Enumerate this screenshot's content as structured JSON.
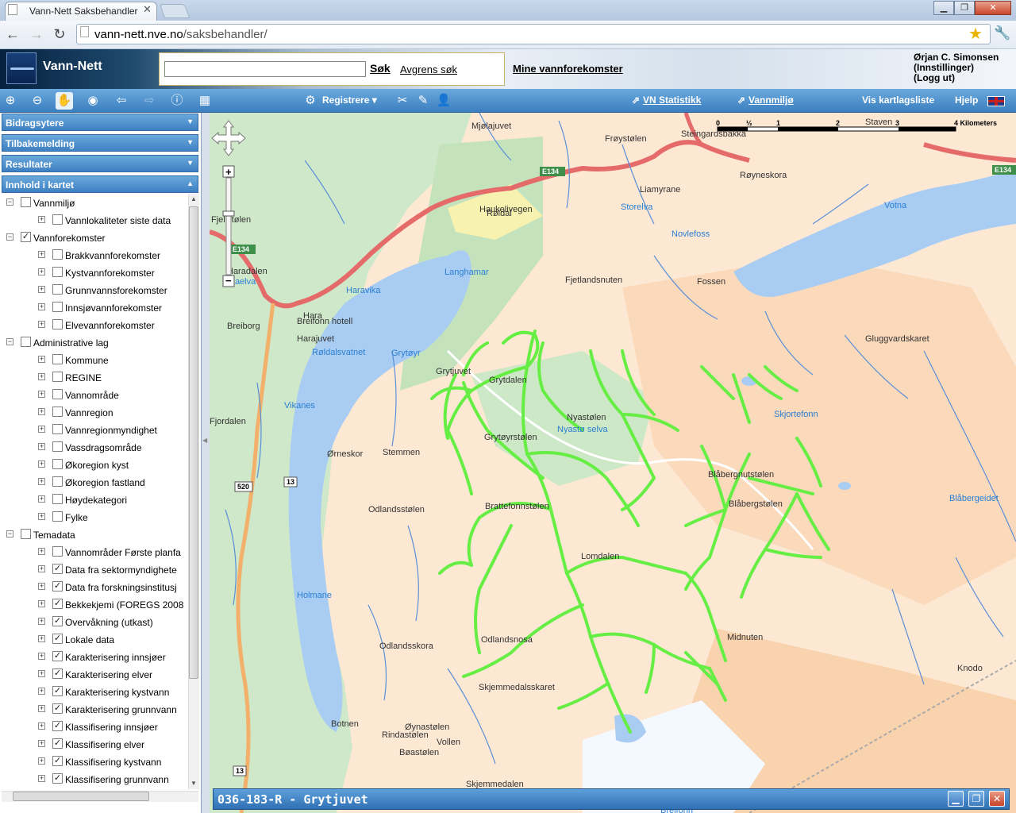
{
  "browser": {
    "tab_title": "Vann-Nett Saksbehandler",
    "url_domain": "vann-nett.nve.no",
    "url_path": "/saksbehandler/"
  },
  "header": {
    "app_title": "Vann-Nett",
    "search_button": "Søk",
    "refine_search": "Avgrens søk",
    "my_water_bodies": "Mine vannforekomster",
    "user_name": "Ørjan C. Simonsen",
    "settings": "(Innstillinger)",
    "logout": "(Logg ut)"
  },
  "toolbar": {
    "register": "Registrere",
    "vn_statistics": "VN Statistikk",
    "water_environment": "Vannmiljø",
    "show_layer_list": "Vis kartlagsliste",
    "help": "Hjelp"
  },
  "sidebar": {
    "panels": [
      "Bidragsytere",
      "Tilbakemelding",
      "Resultater",
      "Innhold i kartet"
    ],
    "tree": [
      {
        "label": "Vannmiljø",
        "level": 0,
        "checked": false,
        "expanded": true
      },
      {
        "label": "Vannlokaliteter siste data",
        "level": 1,
        "checked": false,
        "expanded": false
      },
      {
        "label": "Vannforekomster",
        "level": 0,
        "checked": true,
        "expanded": true
      },
      {
        "label": "Brakkvannforekomster",
        "level": 1,
        "checked": false,
        "expanded": false
      },
      {
        "label": "Kystvannforekomster",
        "level": 1,
        "checked": false,
        "expanded": false
      },
      {
        "label": "Grunnvannsforekomster",
        "level": 1,
        "checked": false,
        "expanded": false
      },
      {
        "label": "Innsjøvannforekomster",
        "level": 1,
        "checked": false,
        "expanded": false
      },
      {
        "label": "Elvevannforekomster",
        "level": 1,
        "checked": false,
        "expanded": false
      },
      {
        "label": "Administrative lag",
        "level": 0,
        "checked": false,
        "expanded": true
      },
      {
        "label": "Kommune",
        "level": 1,
        "checked": false,
        "expanded": false
      },
      {
        "label": "REGINE",
        "level": 1,
        "checked": false,
        "expanded": false
      },
      {
        "label": "Vannområde",
        "level": 1,
        "checked": false,
        "expanded": false
      },
      {
        "label": "Vannregion",
        "level": 1,
        "checked": false,
        "expanded": false
      },
      {
        "label": "Vannregionmyndighet",
        "level": 1,
        "checked": false,
        "expanded": false
      },
      {
        "label": "Vassdragsområde",
        "level": 1,
        "checked": false,
        "expanded": false
      },
      {
        "label": "Økoregion kyst",
        "level": 1,
        "checked": false,
        "expanded": false
      },
      {
        "label": "Økoregion fastland",
        "level": 1,
        "checked": false,
        "expanded": false
      },
      {
        "label": "Høydekategori",
        "level": 1,
        "checked": false,
        "expanded": false
      },
      {
        "label": "Fylke",
        "level": 1,
        "checked": false,
        "expanded": false
      },
      {
        "label": "Temadata",
        "level": 0,
        "checked": false,
        "expanded": true
      },
      {
        "label": "Vannområder Første planfa",
        "level": 1,
        "checked": false,
        "expanded": false
      },
      {
        "label": "Data fra sektormyndighete",
        "level": 1,
        "checked": true,
        "expanded": false
      },
      {
        "label": "Data fra forskningsinstitusj",
        "level": 1,
        "checked": true,
        "expanded": false
      },
      {
        "label": "Bekkekjemi (FOREGS 2008",
        "level": 1,
        "checked": true,
        "expanded": false
      },
      {
        "label": "Overvåkning (utkast)",
        "level": 1,
        "checked": true,
        "expanded": false
      },
      {
        "label": "Lokale data",
        "level": 1,
        "checked": true,
        "expanded": false
      },
      {
        "label": "Karakterisering innsjøer",
        "level": 1,
        "checked": true,
        "expanded": false
      },
      {
        "label": "Karakterisering elver",
        "level": 1,
        "checked": true,
        "expanded": false
      },
      {
        "label": "Karakterisering kystvann",
        "level": 1,
        "checked": true,
        "expanded": false
      },
      {
        "label": "Karakterisering grunnvann",
        "level": 1,
        "checked": true,
        "expanded": false
      },
      {
        "label": "Klassifisering innsjøer",
        "level": 1,
        "checked": true,
        "expanded": false
      },
      {
        "label": "Klassifisering elver",
        "level": 1,
        "checked": true,
        "expanded": false
      },
      {
        "label": "Klassifisering kystvann",
        "level": 1,
        "checked": true,
        "expanded": false
      },
      {
        "label": "Klassifisering grunnvann",
        "level": 1,
        "checked": true,
        "expanded": false
      }
    ]
  },
  "map": {
    "scale_labels": [
      "0",
      "½",
      "1",
      "2",
      "3",
      "4 Kilometers"
    ],
    "road_labels": [
      "E134",
      "E134",
      "E134",
      "520",
      "13",
      "13"
    ],
    "place_labels": [
      "Mjølajuvet",
      "Frøystølen",
      "Steingardsbakka",
      "Staven",
      "Røyneskora",
      "Liamyrane",
      "Storelva",
      "Votna",
      "Novlefoss",
      "Røldal",
      "Fjellstølen",
      "Haukelivegen",
      "Haradalen",
      "Langhamar",
      "Fjetlandsnuten",
      "Fossen",
      "Haravika",
      "Breiborg",
      "Hara",
      "Breifonn hotell",
      "Harajuvet",
      "Røldalsvatnet",
      "Grytøyr",
      "Gluggvardskaret",
      "Grytjuvet",
      "Grytdalen",
      "Nyastølen",
      "Nyastø selva",
      "Skjortefonn",
      "Vikanes",
      "Grytøyrstølen",
      "Ørneskor",
      "Stemmen",
      "Blåbergnutstølen",
      "Blåbergstølen",
      "Blåbergeidet",
      "Brattefonnstølen",
      "Odlandsstølen",
      "Holmane",
      "Lomdalen",
      "Odlandsskora",
      "Odlandsnosa",
      "Midnuten",
      "Knodo",
      "Skjemmedalsskaret",
      "Øynastølen",
      "Botnen",
      "Rindastølen",
      "Vollen",
      "Bøastølen",
      "Skjemmedalen",
      "Breifonn",
      "Fjordalen",
      "Raelva"
    ]
  },
  "info_window": {
    "title": "036-183-R - Grytjuvet"
  },
  "colors": {
    "toolbar_blue": "#4a8fd0",
    "highlight_rivers": "#66ee44",
    "lake": "#a9cdf2",
    "road": "#e56b6b"
  }
}
